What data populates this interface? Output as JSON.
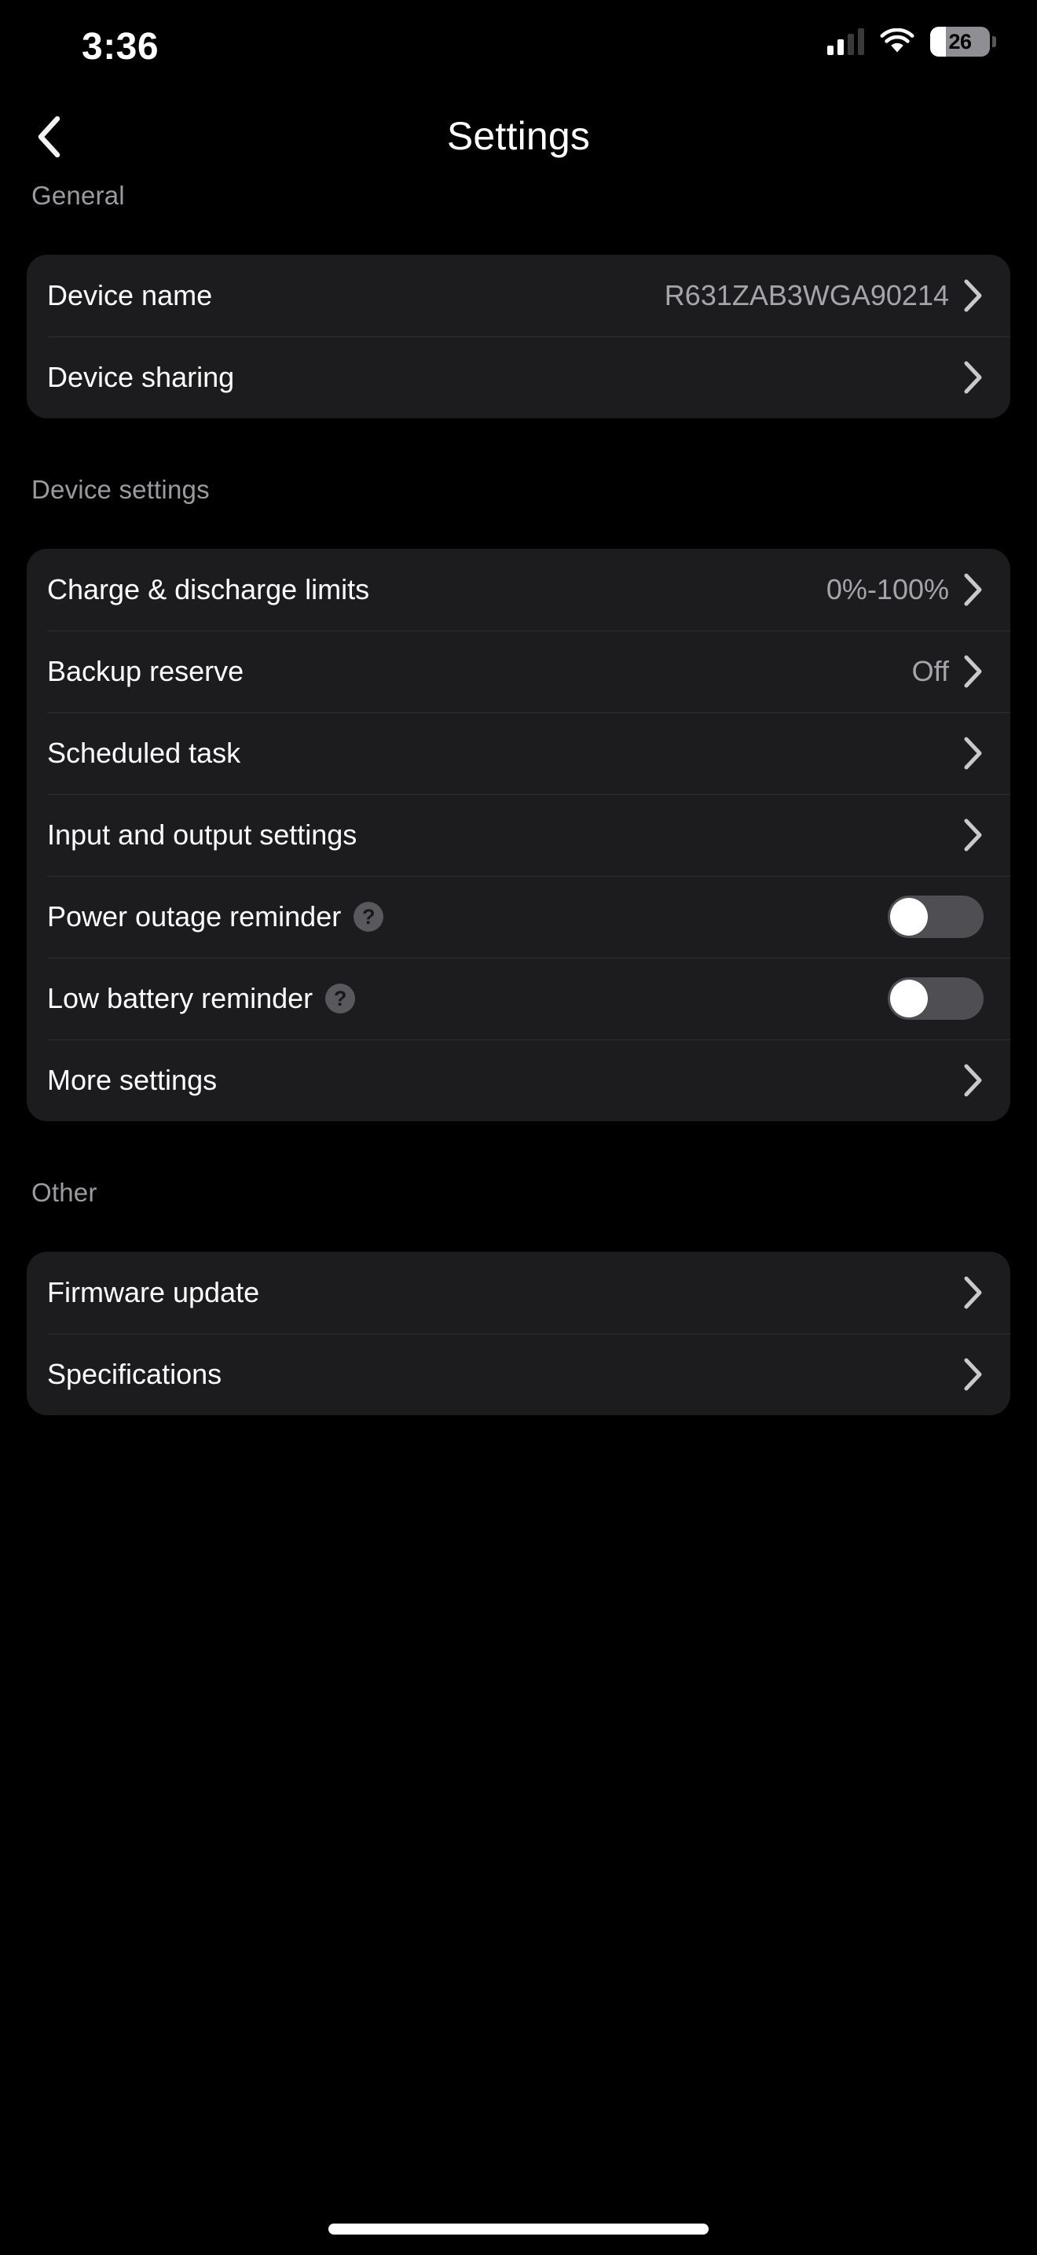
{
  "status_bar": {
    "time": "3:36",
    "signal_icon": "cellular-signal-icon",
    "signal_bars_filled": 2,
    "signal_bars_total": 4,
    "wifi_icon": "wifi-icon",
    "battery_icon": "battery-icon",
    "battery_percent": "26"
  },
  "header": {
    "back_icon": "chevron-left-icon",
    "title": "Settings"
  },
  "sections": [
    {
      "label": "General",
      "rows": [
        {
          "label": "Device name",
          "value": "R631ZAB3WGA90214",
          "accessory": "chevron-right-icon"
        },
        {
          "label": "Device sharing",
          "value": "",
          "accessory": "chevron-right-icon"
        }
      ]
    },
    {
      "label": "Device settings",
      "rows": [
        {
          "label": "Charge & discharge limits",
          "value": "0%-100%",
          "accessory": "chevron-right-icon"
        },
        {
          "label": "Backup reserve",
          "value": "Off",
          "accessory": "chevron-right-icon"
        },
        {
          "label": "Scheduled task",
          "value": "",
          "accessory": "chevron-right-icon"
        },
        {
          "label": "Input and output settings",
          "value": "",
          "accessory": "chevron-right-icon"
        },
        {
          "label": "Power outage reminder",
          "value": "",
          "accessory": "toggle",
          "help": "?",
          "toggle_on": false
        },
        {
          "label": "Low battery reminder",
          "value": "",
          "accessory": "toggle",
          "help": "?",
          "toggle_on": false
        },
        {
          "label": "More settings",
          "value": "",
          "accessory": "chevron-right-icon"
        }
      ]
    },
    {
      "label": "Other",
      "rows": [
        {
          "label": "Firmware update",
          "value": "",
          "accessory": "chevron-right-icon"
        },
        {
          "label": "Specifications",
          "value": "",
          "accessory": "chevron-right-icon"
        }
      ]
    }
  ],
  "colors": {
    "background": "#000000",
    "card": "#1c1c1e",
    "divider": "#2f2f31",
    "label_primary": "#ffffff",
    "label_secondary": "#9b9b9f",
    "value_text": "#a5a5a9",
    "toggle_off_track": "#4f4f53",
    "toggle_knob": "#ffffff",
    "help_badge": "#58585d"
  },
  "home_indicator": "home-indicator"
}
